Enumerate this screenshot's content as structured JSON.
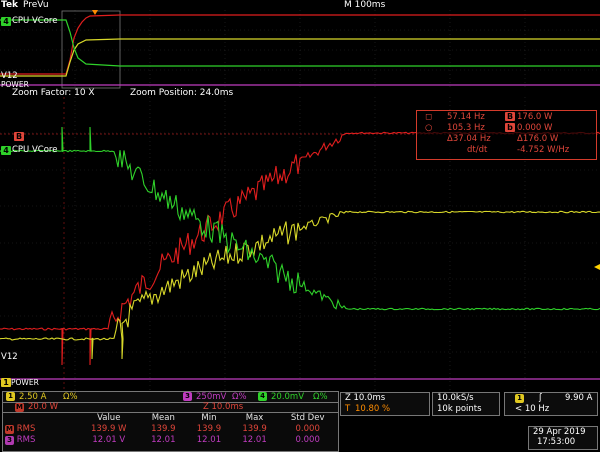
{
  "header": {
    "brand": "Tek",
    "acquisition_mode": "PreVu",
    "timebase": "M 100ms"
  },
  "zoom": {
    "factor": "Zoom Factor: 10 X",
    "position": "Zoom Position: 24.0ms"
  },
  "channel_labels": {
    "cpu_vcore": "CPU VCore",
    "v12": "V12",
    "power": "POWER",
    "ch4_marker": "4",
    "ch1_marker": "1",
    "ch3_marker": "3",
    "chB_marker": "B"
  },
  "cursor_readout": {
    "a_freq": "57.14 Hz",
    "a_val": "176.0 W",
    "b_freq": "105.3 Hz",
    "b_val": "0.000 W",
    "delta_freq": "Δ37.04 Hz",
    "delta_val": "Δ176.0 W",
    "slope_label": "dt/dt",
    "slope_val": "-4.752 W/Hz"
  },
  "channels_bar": {
    "ch1_value": "2.50 A",
    "ch1_suffix": "Ω%",
    "ch3_value": "250mV",
    "ch3_suffix": "Ω%",
    "ch4_value": "20.0mV",
    "ch4_suffix": "Ω%",
    "math_label": "M",
    "math_value": "20.0 W",
    "math_zoom": "Z 10.0ms"
  },
  "zoom_panel": {
    "z_time": "Z 10.0ms",
    "trigger_pct": "10.80 %"
  },
  "sample_panel": {
    "rate": "10.0kS/s",
    "points": "10k points"
  },
  "trigger_panel": {
    "channel": "1",
    "slope": "ʃ",
    "level": "9.90 A",
    "freq": "< 10 Hz"
  },
  "datetime": {
    "date": "29 Apr 2019",
    "time": "17:53:00"
  },
  "measurements": {
    "headers": [
      "",
      "Value",
      "Mean",
      "Min",
      "Max",
      "Std Dev"
    ],
    "rows": [
      {
        "label": "RMS",
        "chip": "M",
        "chip_color": "#c0392b",
        "values": [
          "139.9 W",
          "139.9",
          "139.9",
          "139.9",
          "0.000"
        ]
      },
      {
        "label": "RMS",
        "chip": "3",
        "chip_color": "#b03ab0",
        "values": [
          "12.01 V",
          "12.01",
          "12.01",
          "12.01",
          "0.000"
        ]
      }
    ]
  },
  "colors": {
    "red": "#e01e1e",
    "green": "#2fd12a",
    "yellow": "#d8d82a",
    "magenta": "#c03cc0"
  }
}
